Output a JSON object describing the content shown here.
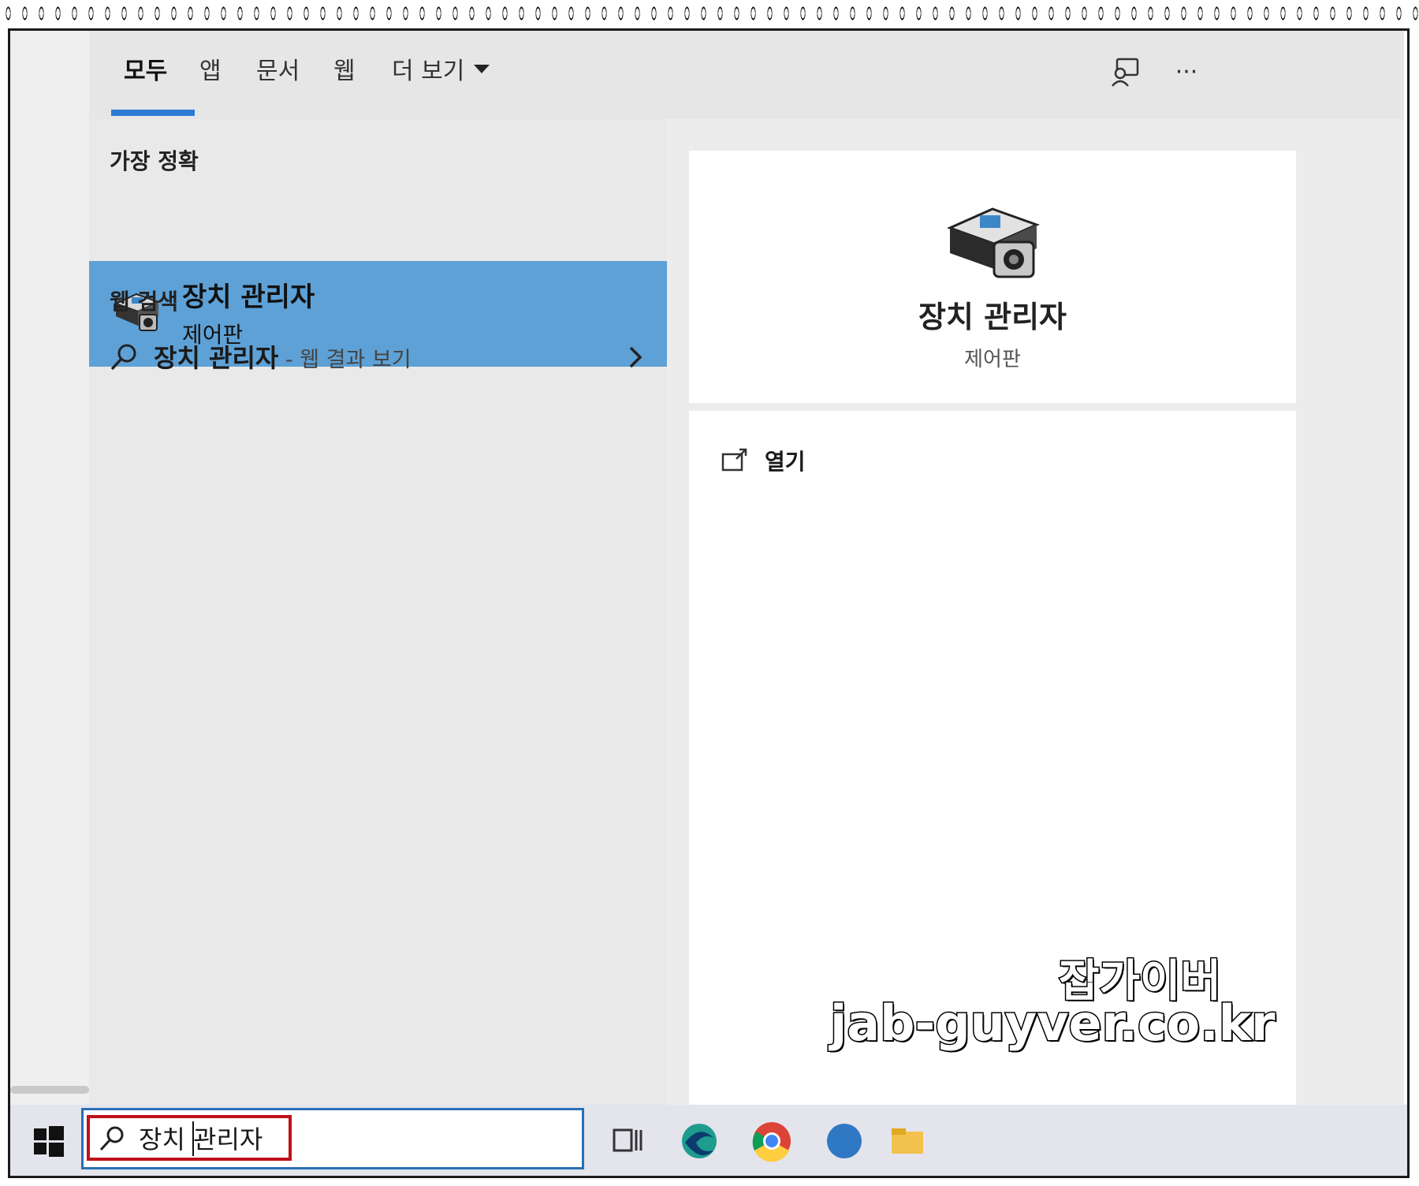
{
  "tabs": [
    {
      "label": "모두",
      "active": true
    },
    {
      "label": "앱"
    },
    {
      "label": "문서"
    },
    {
      "label": "웹"
    },
    {
      "label": "더 보기"
    }
  ],
  "top_icons": [
    "feedback-icon",
    "more-options-icon"
  ],
  "more_label": "···",
  "best_match": {
    "section": "가장 정확",
    "name": "장치 관리자",
    "sub": "제어판",
    "icon": "device-manager-icon"
  },
  "web_search": {
    "section": "웹 검색",
    "query": "장치 관리자",
    "suffix": " - 웹 결과 보기"
  },
  "preview": {
    "title": "장치 관리자",
    "sub": "제어판",
    "open_label": "열기"
  },
  "taskbar": {
    "search_text": "장치 관리자",
    "accent": "#2a6fb3",
    "highlight_color": "#c0101a"
  },
  "watermark": {
    "line1": "잡가이버",
    "line2": "jab-guyver.co.kr"
  },
  "colors": {
    "selected_row": "#5ea1d6",
    "tab_underline": "#2a7bd4"
  }
}
